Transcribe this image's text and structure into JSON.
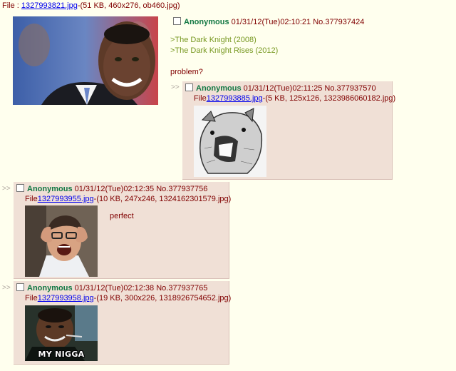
{
  "op": {
    "file_prefix": "File : ",
    "filename": "1327993821.jpg",
    "file_meta": "-(51 KB, 460x276, ob460.jpg)",
    "name": "Anonymous",
    "datetime": "01/31/12(Tue)02:10:21",
    "post_no": "No.377937424",
    "lines": [
      ">The Dark Knight (2008)",
      ">The Dark Knight Rises (2012)"
    ],
    "comment": "problem?"
  },
  "replies": [
    {
      "arrows": ">>",
      "name": "Anonymous",
      "datetime": "01/31/12(Tue)02:11:25",
      "post_no": "No.377937570",
      "file_prefix": "File",
      "filename": "1327993885.jpg",
      "file_meta": "-(5 KB, 125x126, 1323986060182.jpg)",
      "comment": ""
    },
    {
      "arrows": ">>",
      "name": "Anonymous",
      "datetime": "01/31/12(Tue)02:12:35",
      "post_no": "No.377937756",
      "file_prefix": "File",
      "filename": "1327993955.jpg",
      "file_meta": "-(10 KB, 247x246, 1324162301579.jpg)",
      "comment": "perfect"
    },
    {
      "arrows": ">>",
      "name": "Anonymous",
      "datetime": "01/31/12(Tue)02:12:38",
      "post_no": "No.377937765",
      "file_prefix": "File",
      "filename": "1327993958.jpg",
      "file_meta": "-(19 KB, 300x226, 1318926754652.jpg)",
      "comment": "",
      "image_caption": "MY NIGGA"
    }
  ],
  "colors": {
    "background": "#ffffee",
    "reply_bg": "#f0e0d6",
    "name": "#117743",
    "greentext": "#789922",
    "text": "#800000",
    "link": "#0000ee"
  }
}
